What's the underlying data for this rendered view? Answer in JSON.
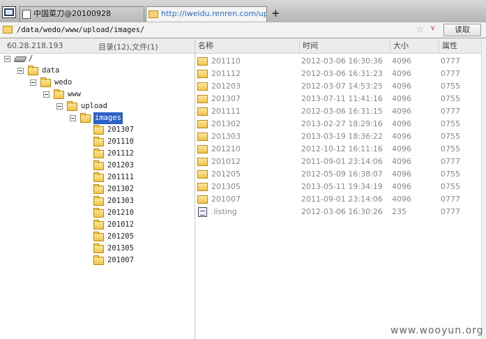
{
  "tabs": [
    {
      "label": "中国菜刀@20100928"
    },
    {
      "label": "http://iweidu.renren.com/uplo..."
    }
  ],
  "new_tab_label": "+",
  "address": {
    "path": "/data/wedo/www/upload/images/",
    "read_button": "读取",
    "star": "☆",
    "dropdown": "∨"
  },
  "left_header": {
    "ip": "60.28.218.193",
    "counts": "目录(12),文件(1)"
  },
  "tree": {
    "root": "/",
    "levels": [
      "data",
      "wedo",
      "www",
      "upload"
    ],
    "selected": "images",
    "children": [
      "201307",
      "201110",
      "201112",
      "201203",
      "201111",
      "201302",
      "201303",
      "201210",
      "201012",
      "201205",
      "201305",
      "201007"
    ]
  },
  "columns": {
    "name": "名称",
    "time": "时间",
    "size": "大小",
    "attr": "属性"
  },
  "files": [
    {
      "name": "201110",
      "time": "2012-03-06 16:30:36",
      "size": "4096",
      "attr": "0777",
      "type": "folder"
    },
    {
      "name": "201112",
      "time": "2012-03-06 16:31:23",
      "size": "4096",
      "attr": "0777",
      "type": "folder"
    },
    {
      "name": "201203",
      "time": "2012-03-07 14:53:25",
      "size": "4096",
      "attr": "0755",
      "type": "folder"
    },
    {
      "name": "201307",
      "time": "2013-07-11 11:41:16",
      "size": "4096",
      "attr": "0755",
      "type": "folder"
    },
    {
      "name": "201111",
      "time": "2012-03-06 16:31:15",
      "size": "4096",
      "attr": "0777",
      "type": "folder"
    },
    {
      "name": "201302",
      "time": "2013-02-27 18:29:16",
      "size": "4096",
      "attr": "0755",
      "type": "folder"
    },
    {
      "name": "201303",
      "time": "2013-03-19 18:36:22",
      "size": "4096",
      "attr": "0755",
      "type": "folder"
    },
    {
      "name": "201210",
      "time": "2012-10-12 16:11:16",
      "size": "4096",
      "attr": "0755",
      "type": "folder"
    },
    {
      "name": "201012",
      "time": "2011-09-01 23:14:06",
      "size": "4096",
      "attr": "0777",
      "type": "folder"
    },
    {
      "name": "201205",
      "time": "2012-05-09 16:38:07",
      "size": "4096",
      "attr": "0755",
      "type": "folder"
    },
    {
      "name": "201305",
      "time": "2013-05-11 19:34:19",
      "size": "4096",
      "attr": "0755",
      "type": "folder"
    },
    {
      "name": "201007",
      "time": "2011-09-01 23:14:06",
      "size": "4096",
      "attr": "0777",
      "type": "folder"
    },
    {
      "name": ".listing",
      "time": "2012-03-06 16:30:26",
      "size": "235",
      "attr": "0777",
      "type": "file"
    }
  ],
  "watermark": "www.wooyun.org",
  "colors": {
    "selection": "#2c61c6",
    "tab_link": "#2a6cc6",
    "folder": "#f3c44a"
  }
}
